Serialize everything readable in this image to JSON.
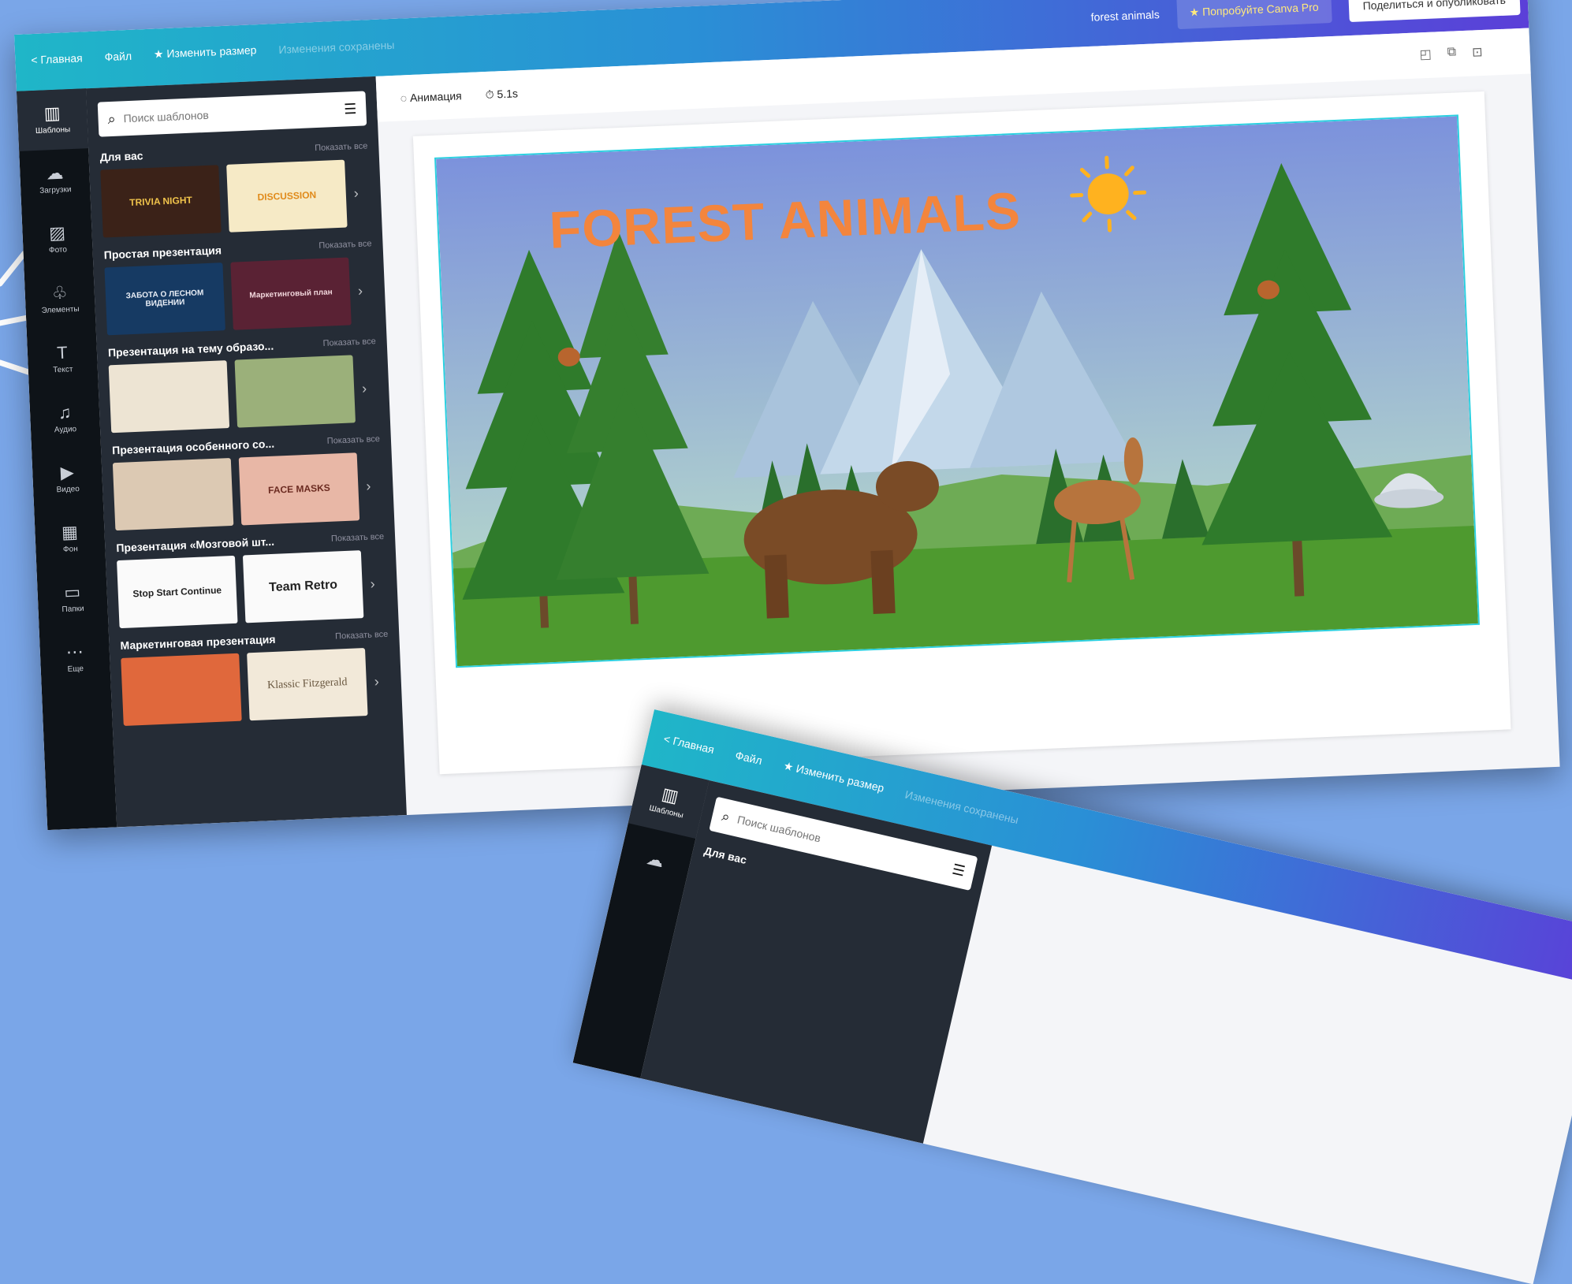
{
  "topbar": {
    "nav": [
      "< Главная",
      "Файл",
      "★ Изменить размер",
      "Изменения сохранены"
    ],
    "design_name": "forest animals",
    "try_pro": "★ Попробуйте Canva Pro",
    "share": "Поделиться и опубликовать"
  },
  "rail": [
    {
      "label": "Шаблоны",
      "icon": "templates-icon"
    },
    {
      "label": "Загрузки",
      "icon": "upload-icon"
    },
    {
      "label": "Фото",
      "icon": "photo-icon"
    },
    {
      "label": "Элементы",
      "icon": "elements-icon"
    },
    {
      "label": "Текст",
      "icon": "text-icon"
    },
    {
      "label": "Аудио",
      "icon": "audio-icon"
    },
    {
      "label": "Видео",
      "icon": "video-icon"
    },
    {
      "label": "Фон",
      "icon": "background-icon"
    },
    {
      "label": "Папки",
      "icon": "folder-icon"
    },
    {
      "label": "Еще",
      "icon": "more-icon"
    }
  ],
  "panel": {
    "search_placeholder": "Поиск шаблонов",
    "show_all": "Показать все",
    "sections": [
      {
        "title": "Для вас",
        "thumbs": [
          "TRIVIA NIGHT",
          "DISCUSSION"
        ]
      },
      {
        "title": "Простая презентация",
        "thumbs": [
          "ЗАБОТА О ЛЕСНОМ ВИДЕНИИ",
          "Маркетинговый план"
        ]
      },
      {
        "title": "Презентация на тему образо...",
        "thumbs": [
          "",
          ""
        ]
      },
      {
        "title": "Презентация особенного со...",
        "thumbs": [
          "",
          "FACE MASKS"
        ]
      },
      {
        "title": "Презентация «Мозговой шт...",
        "thumbs": [
          "Stop Start Continue",
          "Team Retro"
        ]
      },
      {
        "title": "Маркетинговая презентация",
        "thumbs": [
          "",
          "Klassic Fitzgerald"
        ]
      }
    ]
  },
  "toolbar": {
    "animation": "Анимация",
    "timing": "5.1s"
  },
  "canvas": {
    "title": "FOREST ANIMALS",
    "sky_top": "#7c92dc",
    "sky_bottom": "#bfe3c9",
    "grass": "#4e9a2f",
    "tree_green": "#2f7b2b",
    "sun": "#ffb21f"
  },
  "second_window": {
    "nav": [
      "< Главная",
      "Файл",
      "★ Изменить размер",
      "Изменения сохранены"
    ],
    "rail_label": "Шаблоны",
    "search_placeholder": "Поиск шаблонов",
    "section_title": "Для вас"
  }
}
